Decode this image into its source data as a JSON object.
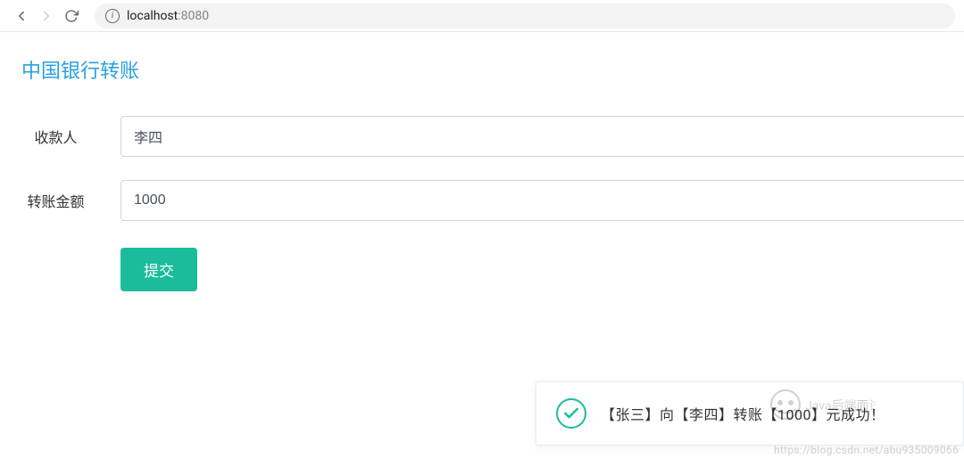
{
  "browser": {
    "url_host": "localhost",
    "url_port": ":8080"
  },
  "page": {
    "legend": "中国银行转账",
    "form": {
      "payee_label": "收款人",
      "payee_value": "李四",
      "amount_label": "转账金额",
      "amount_value": "1000",
      "submit_label": "提交"
    }
  },
  "toast": {
    "message": "【张三】向【李四】转账【1000】元成功！"
  },
  "watermark": {
    "text1": "Java后端面试官",
    "text2": "https://blog.csdn.net/abu935009066"
  }
}
